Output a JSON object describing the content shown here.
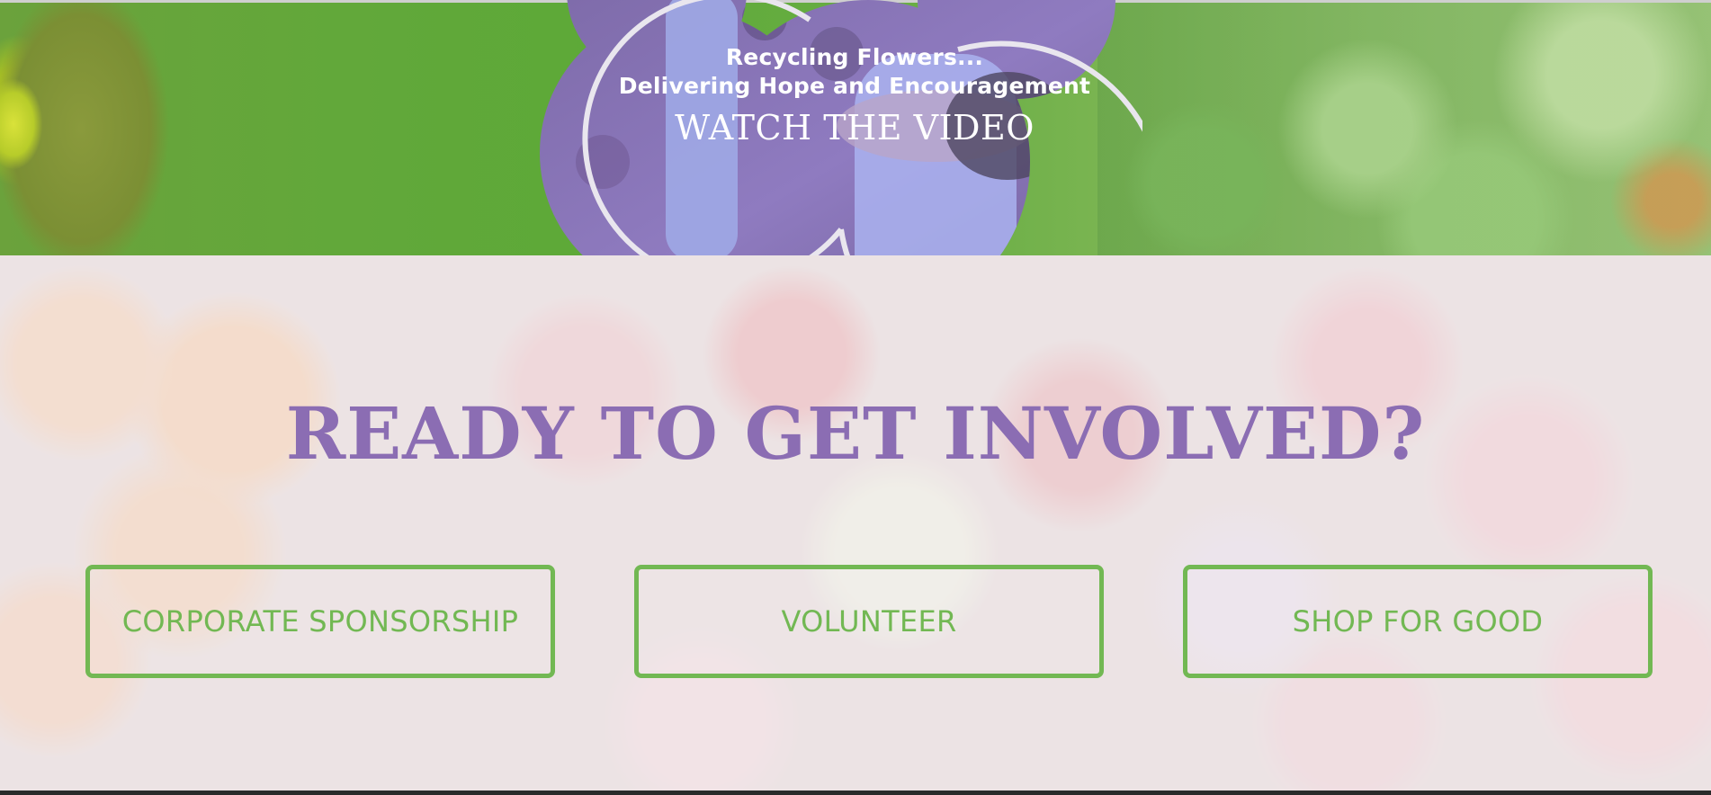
{
  "video": {
    "line1": "Recycling Flowers...",
    "line2": "Delivering Hope and Encouragement",
    "watch_label": "WATCH THE VIDEO"
  },
  "involve": {
    "heading": "READY TO GET INVOLVED?",
    "buttons": [
      {
        "label": "CORPORATE SPONSORSHIP"
      },
      {
        "label": "VOLUNTEER"
      },
      {
        "label": "SHOP FOR GOOD"
      }
    ]
  },
  "colors": {
    "heading_purple": "#8b6db3",
    "cta_green": "#72b853",
    "hero_green": "#5da938"
  }
}
